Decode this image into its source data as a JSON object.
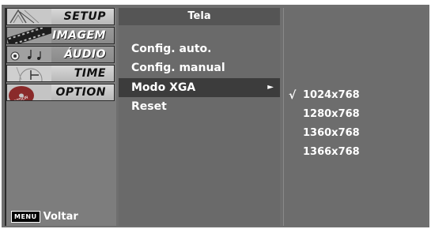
{
  "sidebar": {
    "categories": [
      {
        "label": "SETUP",
        "icon": "setup-thumbnail-icon",
        "active": true
      },
      {
        "label": "IMAGEM",
        "icon": "film-strip-icon",
        "active": false
      },
      {
        "label": "ÁUDIO",
        "icon": "audio-notes-icon",
        "active": false
      },
      {
        "label": "TIME",
        "icon": "clock-icon",
        "active": true
      },
      {
        "label": "OPTION",
        "icon": "option-disc-icon",
        "active": true
      }
    ],
    "menu_key": "MENU",
    "menu_action": "Voltar"
  },
  "panel": {
    "title": "Tela",
    "items": [
      {
        "label": "Config. auto.",
        "highlight": false
      },
      {
        "label": "Config. manual",
        "highlight": false
      },
      {
        "label": "Modo XGA",
        "highlight": true,
        "arrow": "►"
      },
      {
        "label": "Reset",
        "highlight": false
      }
    ]
  },
  "options": {
    "items": [
      {
        "label": "1024x768",
        "selected": true,
        "check": "√"
      },
      {
        "label": "1280x768",
        "selected": false,
        "check": ""
      },
      {
        "label": "1360x768",
        "selected": false,
        "check": ""
      },
      {
        "label": "1366x768",
        "selected": false,
        "check": ""
      }
    ]
  }
}
